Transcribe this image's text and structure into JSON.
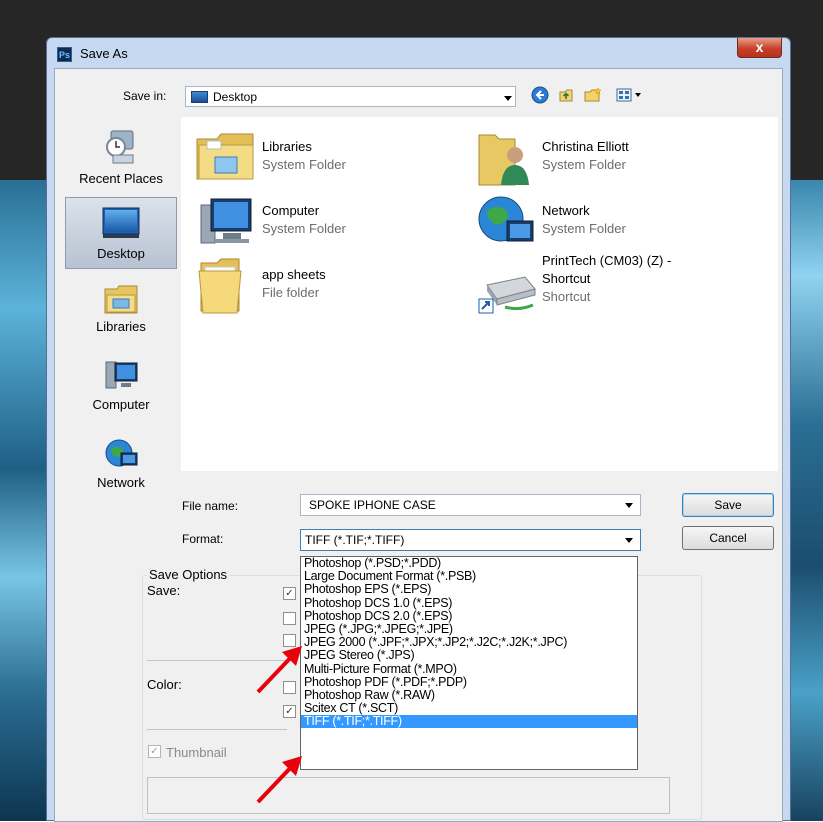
{
  "dialog": {
    "title": "Save As",
    "app_icon": "Ps",
    "close_glyph": "x"
  },
  "save_in": {
    "label": "Save in:",
    "value": "Desktop"
  },
  "places": [
    {
      "label": "Recent Places",
      "icon": "recent-places-icon"
    },
    {
      "label": "Desktop",
      "icon": "desktop-icon",
      "selected": true
    },
    {
      "label": "Libraries",
      "icon": "libraries-icon"
    },
    {
      "label": "Computer",
      "icon": "computer-icon"
    },
    {
      "label": "Network",
      "icon": "network-icon"
    }
  ],
  "files": [
    {
      "name": "Libraries",
      "type": "System Folder",
      "icon": "libraries-folder-icon"
    },
    {
      "name": "Christina Elliott",
      "type": "System Folder",
      "icon": "user-folder-icon"
    },
    {
      "name": "Computer",
      "type": "System Folder",
      "icon": "computer-icon"
    },
    {
      "name": "Network",
      "type": "System Folder",
      "icon": "network-globe-icon"
    },
    {
      "name": "app sheets",
      "type": "File folder",
      "icon": "folder-icon"
    },
    {
      "name_line1": "PrintTech (CM03) (Z) -",
      "name_line2": "Shortcut",
      "type": "Shortcut",
      "icon": "network-drive-shortcut-icon"
    }
  ],
  "file_name": {
    "label": "File name:",
    "value": "SPOKE IPHONE CASE"
  },
  "format": {
    "label": "Format:",
    "value": "TIFF (*.TIF;*.TIFF)",
    "options": [
      "Photoshop (*.PSD;*.PDD)",
      "Large Document Format (*.PSB)",
      "Photoshop EPS (*.EPS)",
      "Photoshop DCS 1.0 (*.EPS)",
      "Photoshop DCS 2.0 (*.EPS)",
      "JPEG (*.JPG;*.JPEG;*.JPE)",
      "JPEG 2000 (*.JPF;*.JPX;*.JP2;*.J2C;*.J2K;*.JPC)",
      "JPEG Stereo (*.JPS)",
      "Multi-Picture Format (*.MPO)",
      "Photoshop PDF (*.PDF;*.PDP)",
      "Photoshop Raw (*.RAW)",
      "Scitex CT (*.SCT)",
      "TIFF (*.TIF;*.TIFF)"
    ],
    "selected_index": 12
  },
  "buttons": {
    "save": "Save",
    "cancel": "Cancel"
  },
  "save_options": {
    "group_label": "Save Options",
    "save_label": "Save:",
    "color_label": "Color:",
    "thumbnail_label": "Thumbnail"
  },
  "colors": {
    "selection": "#3399ff",
    "annotation_arrow": "#e8000b"
  }
}
